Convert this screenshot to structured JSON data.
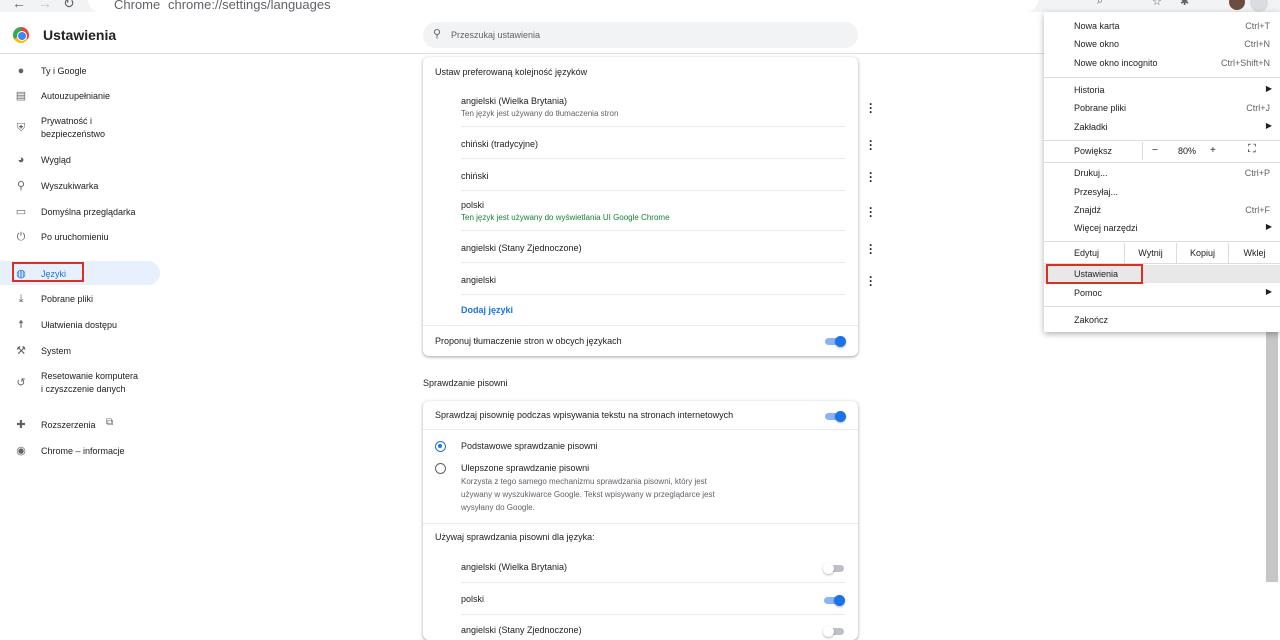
{
  "browser": {
    "site_label": "Chrome",
    "url": "chrome://settings/languages"
  },
  "header": {
    "title": "Ustawienia",
    "search_placeholder": "Przeszukaj ustawienia"
  },
  "sidebar": {
    "items": [
      {
        "label": "Ty i Google",
        "icon": "person-icon"
      },
      {
        "label": "Autouzupełnianie",
        "icon": "clipboard-icon"
      },
      {
        "label": "Prywatność i\nbezpieczeństwo",
        "icon": "shield-icon"
      },
      {
        "label": "Wygląd",
        "icon": "palette-icon"
      },
      {
        "label": "Wyszukiwarka",
        "icon": "search-icon"
      },
      {
        "label": "Domyślna przeglądarka",
        "icon": "browser-icon"
      },
      {
        "label": "Po uruchomieniu",
        "icon": "power-icon"
      },
      {
        "label": "Języki",
        "icon": "globe-icon"
      },
      {
        "label": "Pobrane pliki",
        "icon": "download-icon"
      },
      {
        "label": "Ułatwienia dostępu",
        "icon": "accessibility-icon"
      },
      {
        "label": "System",
        "icon": "wrench-icon"
      },
      {
        "label": "Resetowanie komputera\ni czyszczenie danych",
        "icon": "history-icon"
      },
      {
        "label": "Rozszerzenia",
        "icon": "puzzle-icon"
      },
      {
        "label": "Chrome – informacje",
        "icon": "chrome-icon"
      }
    ]
  },
  "languages": {
    "heading": "Ustaw preferowaną kolejność języków",
    "items": [
      {
        "name": "angielski (Wielka Brytania)",
        "note": "Ten język jest używany do tłumaczenia stron"
      },
      {
        "name": "chiński (tradycyjne)",
        "note": ""
      },
      {
        "name": "chiński",
        "note": ""
      },
      {
        "name": "polski",
        "note": "Ten język jest używany do wyświetlania UI Google Chrome"
      },
      {
        "name": "angielski (Stany Zjednoczone)",
        "note": ""
      },
      {
        "name": "angielski",
        "note": ""
      }
    ],
    "add_link": "Dodaj języki",
    "translate_offer": "Proponuj tłumaczenie stron w obcych językach",
    "translate_offer_on": true
  },
  "spellcheck": {
    "section_title": "Sprawdzanie pisowni",
    "enable_label": "Sprawdzaj pisownię podczas wpisywania tekstu na stronach internetowych",
    "enable_on": true,
    "basic_label": "Podstawowe sprawdzanie pisowni",
    "enhanced_label": "Ulepszone sprawdzanie pisowni",
    "enhanced_desc": "Korzysta z tego samego mechanizmu sprawdzania pisowni, który jest\nużywany w wyszukiwarce Google. Tekst wpisywany w przeglądarce jest\nwysyłany do Google.",
    "selected": "basic",
    "lang_heading": "Używaj sprawdzania pisowni dla języka:",
    "langs": [
      {
        "name": "angielski (Wielka Brytania)",
        "on": false
      },
      {
        "name": "polski",
        "on": true
      },
      {
        "name": "angielski (Stany Zjednoczone)",
        "on": false
      }
    ]
  },
  "menu": {
    "new_tab": "Nowa karta",
    "new_tab_key": "Ctrl+T",
    "new_window": "Nowe okno",
    "new_window_key": "Ctrl+N",
    "incognito": "Nowe okno incognito",
    "incognito_key": "Ctrl+Shift+N",
    "history": "Historia",
    "downloads": "Pobrane pliki",
    "downloads_key": "Ctrl+J",
    "bookmarks": "Zakładki",
    "zoom": "Powiększ",
    "zoom_minus": "−",
    "zoom_value": "80%",
    "zoom_plus": "+",
    "print": "Drukuj...",
    "print_key": "Ctrl+P",
    "cast": "Przesyłaj...",
    "find": "Znajdź",
    "find_key": "Ctrl+F",
    "more_tools": "Więcej narzędzi",
    "edit": "Edytuj",
    "cut": "Wytnij",
    "copy": "Kopiuj",
    "paste": "Wklej",
    "settings": "Ustawienia",
    "help": "Pomoc",
    "exit": "Zakończ"
  }
}
